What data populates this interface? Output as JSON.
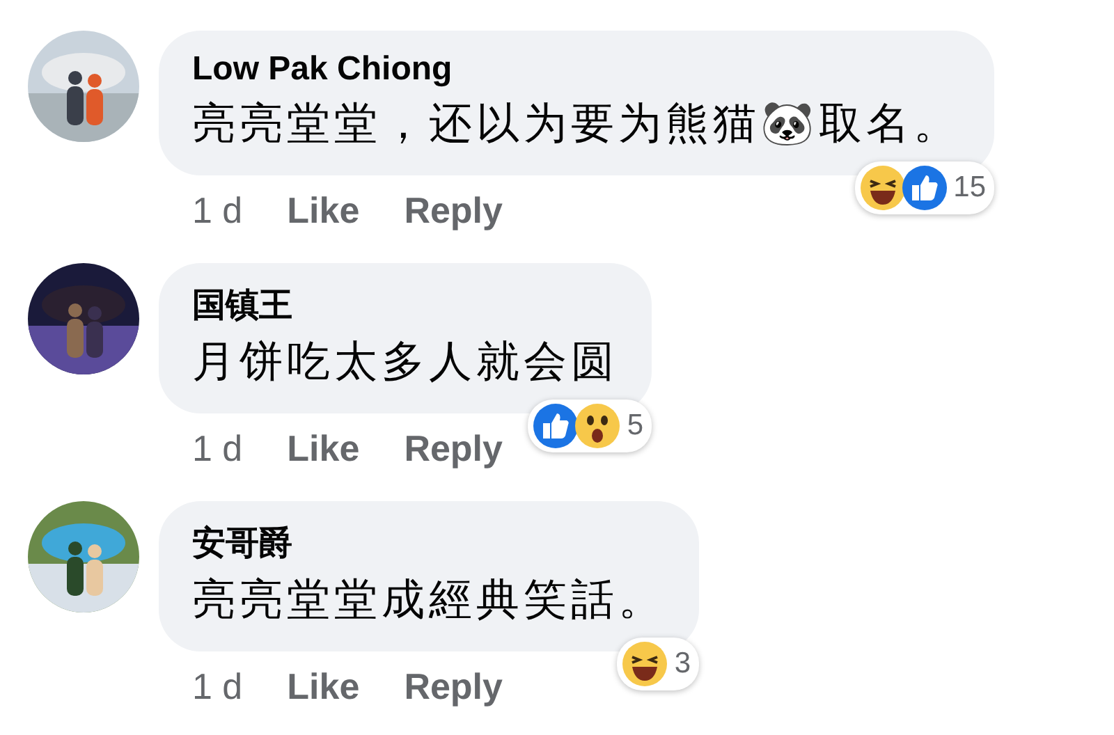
{
  "comments": [
    {
      "author": "Low Pak Chiong",
      "text": "亮亮堂堂，还以为要为熊猫🐼取名。",
      "time": "1 d",
      "actions": [
        "Like",
        "Reply"
      ],
      "reactions": [
        {
          "kind": "haha"
        },
        {
          "kind": "like"
        }
      ],
      "reaction_count": "15",
      "avatar": {
        "kind": "picture"
      }
    },
    {
      "author": "国镇王",
      "text": "月饼吃太多人就会圆",
      "time": "1 d",
      "actions": [
        "Like",
        "Reply"
      ],
      "reactions": [
        {
          "kind": "like"
        },
        {
          "kind": "wow"
        }
      ],
      "reaction_count": "5",
      "avatar": {
        "kind": "picture"
      }
    },
    {
      "author": "安哥爵",
      "text": "亮亮堂堂成經典笑話。",
      "time": "1 d",
      "actions": [
        "Like",
        "Reply"
      ],
      "reactions": [
        {
          "kind": "haha"
        }
      ],
      "reaction_count": "3",
      "avatar": {
        "kind": "picture"
      }
    }
  ]
}
